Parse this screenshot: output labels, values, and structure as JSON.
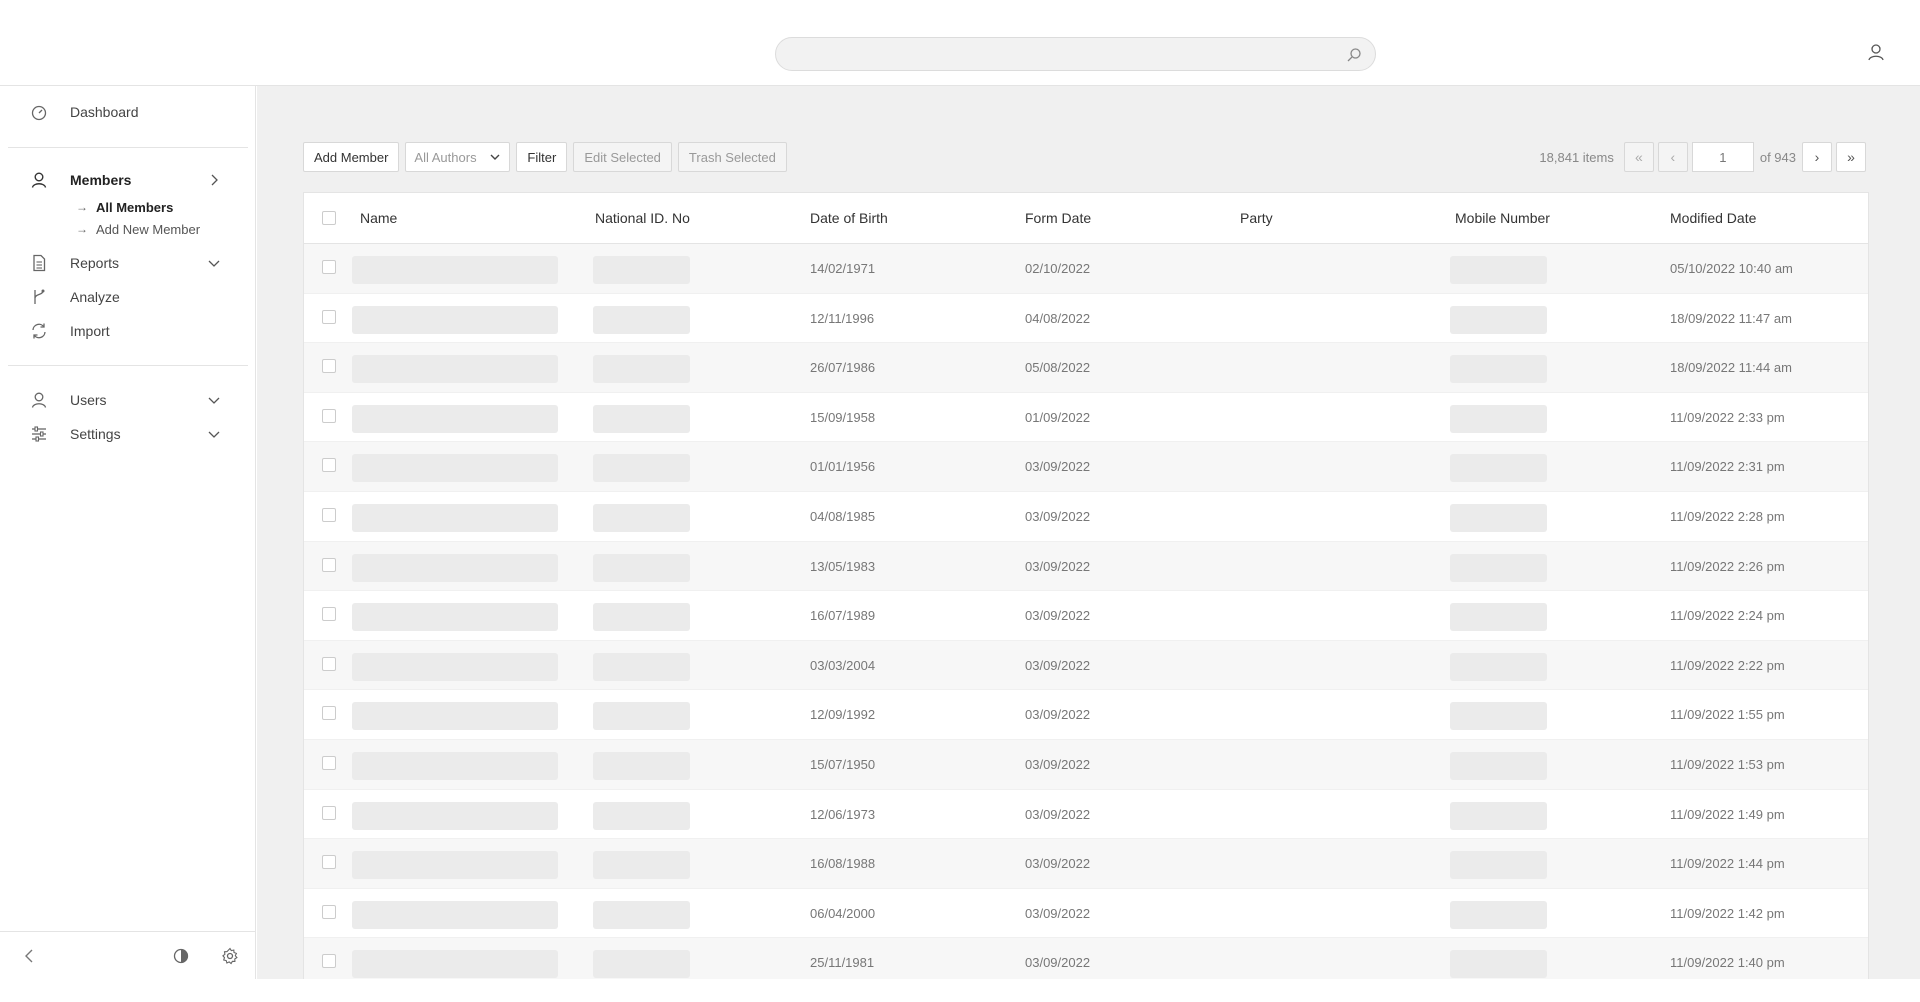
{
  "search": {
    "placeholder": "",
    "icon": "search-icon"
  },
  "header": {
    "user_icon": "user-icon"
  },
  "sidebar": {
    "dashboard": "Dashboard",
    "members": "Members",
    "members_sub": [
      "All Members",
      "Add New Member"
    ],
    "reports": "Reports",
    "analyze": "Analyze",
    "import": "Import",
    "users": "Users",
    "settings": "Settings"
  },
  "toolbar": {
    "add_member": "Add Member",
    "authors_select": "All Authors",
    "filter": "Filter",
    "edit_selected": "Edit Selected",
    "trash_selected": "Trash Selected"
  },
  "pagination": {
    "items": "18,841 items",
    "first": "«",
    "prev": "‹",
    "current_page": "1",
    "of_pages": "of 943",
    "next": "›",
    "last": "»"
  },
  "table": {
    "columns": [
      "Name",
      "National ID. No",
      "Date of Birth",
      "Form Date",
      "Party",
      "Mobile Number",
      "Modified Date"
    ],
    "rows": [
      {
        "dob": "14/02/1971",
        "form": "02/10/2022",
        "modified": "05/10/2022 10:40 am"
      },
      {
        "dob": "12/11/1996",
        "form": "04/08/2022",
        "modified": "18/09/2022 11:47 am"
      },
      {
        "dob": "26/07/1986",
        "form": "05/08/2022",
        "modified": "18/09/2022 11:44 am"
      },
      {
        "dob": "15/09/1958",
        "form": "01/09/2022",
        "modified": "11/09/2022 2:33 pm"
      },
      {
        "dob": "01/01/1956",
        "form": "03/09/2022",
        "modified": "11/09/2022 2:31 pm"
      },
      {
        "dob": "04/08/1985",
        "form": "03/09/2022",
        "modified": "11/09/2022 2:28 pm"
      },
      {
        "dob": "13/05/1983",
        "form": "03/09/2022",
        "modified": "11/09/2022 2:26 pm"
      },
      {
        "dob": "16/07/1989",
        "form": "03/09/2022",
        "modified": "11/09/2022 2:24 pm"
      },
      {
        "dob": "03/03/2004",
        "form": "03/09/2022",
        "modified": "11/09/2022 2:22 pm"
      },
      {
        "dob": "12/09/1992",
        "form": "03/09/2022",
        "modified": "11/09/2022 1:55 pm"
      },
      {
        "dob": "15/07/1950",
        "form": "03/09/2022",
        "modified": "11/09/2022 1:53 pm"
      },
      {
        "dob": "12/06/1973",
        "form": "03/09/2022",
        "modified": "11/09/2022 1:49 pm"
      },
      {
        "dob": "16/08/1988",
        "form": "03/09/2022",
        "modified": "11/09/2022 1:44 pm"
      },
      {
        "dob": "06/04/2000",
        "form": "03/09/2022",
        "modified": "11/09/2022 1:42 pm"
      },
      {
        "dob": "25/11/1981",
        "form": "03/09/2022",
        "modified": "11/09/2022 1:40 pm"
      }
    ]
  }
}
